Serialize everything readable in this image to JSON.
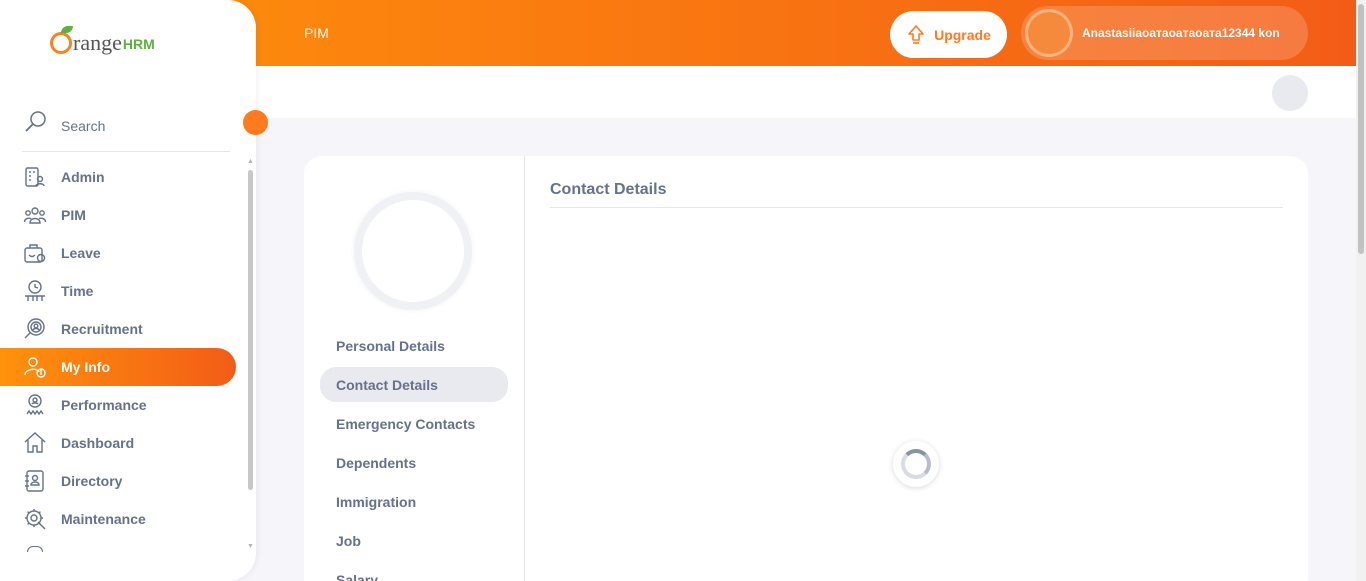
{
  "topbar": {
    "module": "PIM",
    "upgrade_label": "Upgrade",
    "user_name": "Anastasiiaoатаоатаоата12344 kon"
  },
  "sidebar": {
    "brand_main": "range",
    "brand_hrm": "HRM",
    "search_placeholder": "Search",
    "items": [
      {
        "label": "Admin",
        "icon": "admin-icon"
      },
      {
        "label": "PIM",
        "icon": "pim-icon"
      },
      {
        "label": "Leave",
        "icon": "leave-icon"
      },
      {
        "label": "Time",
        "icon": "time-icon"
      },
      {
        "label": "Recruitment",
        "icon": "recruitment-icon"
      },
      {
        "label": "My Info",
        "icon": "my-info-icon",
        "active": true
      },
      {
        "label": "Performance",
        "icon": "performance-icon"
      },
      {
        "label": "Dashboard",
        "icon": "dashboard-icon"
      },
      {
        "label": "Directory",
        "icon": "directory-icon"
      },
      {
        "label": "Maintenance",
        "icon": "maintenance-icon"
      }
    ]
  },
  "profile": {
    "tabs": [
      {
        "label": "Personal Details"
      },
      {
        "label": "Contact Details",
        "active": true
      },
      {
        "label": "Emergency Contacts"
      },
      {
        "label": "Dependents"
      },
      {
        "label": "Immigration"
      },
      {
        "label": "Job"
      },
      {
        "label": "Salary"
      }
    ]
  },
  "content": {
    "title": "Contact Details"
  },
  "colors": {
    "accent": "#ff7b1d",
    "gradient_start": "#ff920b",
    "gradient_end": "#f35c17",
    "text": "#64728c"
  }
}
